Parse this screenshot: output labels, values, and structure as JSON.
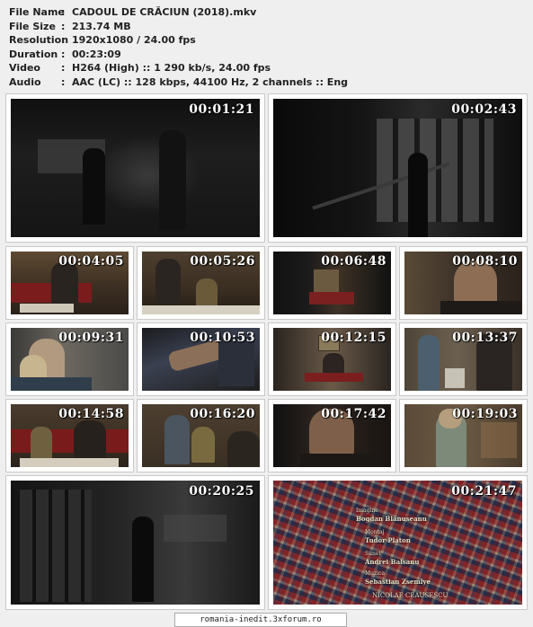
{
  "info": {
    "file_name_label": "File Name",
    "file_name": "CADOUL DE CRĂCIUN (2018).mkv",
    "file_size_label": "File Size",
    "file_size": "213.74 MB",
    "resolution_label": "Resolution",
    "resolution": "1920x1080 / 24.00 fps",
    "duration_label": "Duration",
    "duration": "00:23:09",
    "video_label": "Video",
    "video": "H264 (High) :: 1 290 kb/s, 24.00 fps",
    "audio_label": "Audio",
    "audio": "AAC (LC) :: 128 kbps, 44100 Hz, 2 channels :: Eng",
    "separator": ":"
  },
  "thumbnails": [
    {
      "time": "00:01:21",
      "scene": "dark street night"
    },
    {
      "time": "00:02:43",
      "scene": "dark staircase window"
    },
    {
      "time": "00:04:05",
      "scene": "man sitting red sofa"
    },
    {
      "time": "00:05:26",
      "scene": "family at table"
    },
    {
      "time": "00:06:48",
      "scene": "room with table"
    },
    {
      "time": "00:08:10",
      "scene": "man close-up"
    },
    {
      "time": "00:09:31",
      "scene": "woman close-up"
    },
    {
      "time": "00:10:53",
      "scene": "hands in dark"
    },
    {
      "time": "00:12:15",
      "scene": "man at table in room"
    },
    {
      "time": "00:13:37",
      "scene": "woman and man in room"
    },
    {
      "time": "00:14:58",
      "scene": "boy and man on sofa"
    },
    {
      "time": "00:16:20",
      "scene": "children at table"
    },
    {
      "time": "00:17:42",
      "scene": "man face close-up"
    },
    {
      "time": "00:19:03",
      "scene": "woman in kitchen"
    },
    {
      "time": "00:20:25",
      "scene": "dark corridor figure"
    },
    {
      "time": "00:21:47",
      "scene": "crowd poster credits"
    }
  ],
  "credits": [
    {
      "role": "Imagine",
      "name": "Bogdan Blanuseanu"
    },
    {
      "role": "Montaj",
      "name": "Tudor Platon"
    },
    {
      "role": "Sunet",
      "name": "Andrei Balsanu"
    },
    {
      "role": "Muzica",
      "name": "Sebastian Zsemlye"
    },
    {
      "role": "",
      "name": "NICOLAE CEAUSESCU"
    }
  ],
  "footer": "romania-inedit.3xforum.ro"
}
